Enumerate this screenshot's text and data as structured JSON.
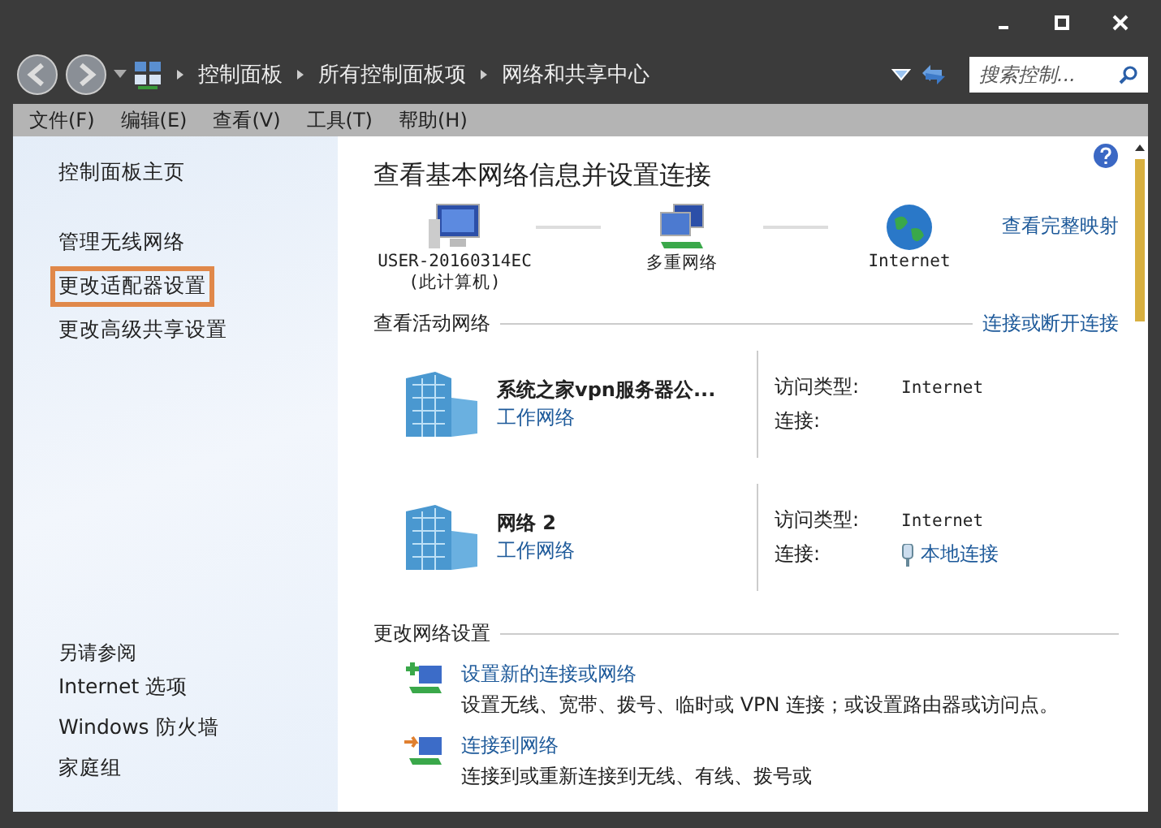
{
  "address_bar": {
    "breadcrumbs": [
      "控制面板",
      "所有控制面板项",
      "网络和共享中心"
    ],
    "search": {
      "placeholder": "搜索控制..."
    }
  },
  "menu": [
    "文件(F)",
    "编辑(E)",
    "查看(V)",
    "工具(T)",
    "帮助(H)"
  ],
  "sidebar": {
    "items": [
      {
        "label": "控制面板主页",
        "kind": "home",
        "highlighted": false
      },
      {
        "label": "管理无线网络",
        "kind": "task",
        "highlighted": false
      },
      {
        "label": "更改适配器设置",
        "kind": "task",
        "highlighted": true
      },
      {
        "label": "更改高级共享设置",
        "kind": "task",
        "highlighted": false
      }
    ],
    "see_also": {
      "heading": "另请参阅",
      "items": [
        "Internet 选项",
        "Windows 防火墙",
        "家庭组"
      ]
    }
  },
  "main": {
    "title": "查看基本网络信息并设置连接",
    "full_map_link": "查看完整映射",
    "map": [
      {
        "kind": "computer",
        "label": "USER-20160314EC",
        "sublabel": "(此计算机)"
      },
      {
        "kind": "multi",
        "label": "多重网络"
      },
      {
        "kind": "internet",
        "label": "Internet"
      }
    ],
    "active": {
      "heading": "查看活动网络",
      "link": "连接或断开连接",
      "networks": [
        {
          "name": "系统之家vpn服务器公...",
          "type": "工作网络",
          "access_label": "访问类型:",
          "access": "Internet",
          "conn_label": "连接:"
        },
        {
          "name": "网络  2",
          "type": "工作网络",
          "access_label": "访问类型:",
          "access": "Internet",
          "conn_label": "连接:",
          "conn": "本地连接"
        }
      ]
    },
    "settings": {
      "heading": "更改网络设置",
      "tasks": [
        {
          "kind": "new",
          "title": "设置新的连接或网络",
          "description": "设置无线、宽带、拨号、临时或 VPN 连接；或设置路由器或访问点。"
        },
        {
          "kind": "connect",
          "title": "连接到网络",
          "description": "连接到或重新连接到无线、有线、拨号或"
        }
      ]
    }
  }
}
